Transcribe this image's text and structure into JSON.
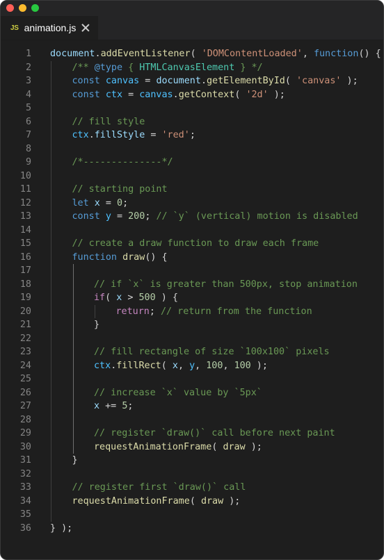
{
  "window": {
    "controls": [
      "close",
      "minimize",
      "maximize"
    ],
    "colors": {
      "close": "#ff5f57",
      "minimize": "#febc2e",
      "maximize": "#28c840"
    }
  },
  "tab": {
    "icon_text": "JS",
    "icon": "javascript-file-icon",
    "label": "animation.js",
    "close_icon": "close-icon"
  },
  "theme": {
    "background": "#1e1e1e",
    "keyword": "#569cd6",
    "string": "#ce9178",
    "number": "#b5cea8",
    "comment": "#6a9955",
    "function": "#dcdcaa",
    "variable": "#9cdcfe"
  },
  "lines": [
    {
      "n": "1",
      "indent": 0,
      "tokens": [
        {
          "t": "document",
          "c": "var"
        },
        {
          "t": ".",
          "c": "plain"
        },
        {
          "t": "addEventListener",
          "c": "func"
        },
        {
          "t": "( ",
          "c": "plain"
        },
        {
          "t": "'DOMContentLoaded'",
          "c": "string"
        },
        {
          "t": ", ",
          "c": "plain"
        },
        {
          "t": "function",
          "c": "keyword"
        },
        {
          "t": "() {",
          "c": "plain"
        }
      ]
    },
    {
      "n": "2",
      "indent": 1,
      "tokens": [
        {
          "t": "/** ",
          "c": "comment"
        },
        {
          "t": "@type",
          "c": "keyword"
        },
        {
          "t": " { ",
          "c": "comment"
        },
        {
          "t": "HTMLCanvasElement",
          "c": "type"
        },
        {
          "t": " } */",
          "c": "comment"
        }
      ]
    },
    {
      "n": "3",
      "indent": 1,
      "tokens": [
        {
          "t": "const",
          "c": "keyword"
        },
        {
          "t": " ",
          "c": "plain"
        },
        {
          "t": "canvas",
          "c": "const"
        },
        {
          "t": " = ",
          "c": "plain"
        },
        {
          "t": "document",
          "c": "var"
        },
        {
          "t": ".",
          "c": "plain"
        },
        {
          "t": "getElementById",
          "c": "func"
        },
        {
          "t": "( ",
          "c": "plain"
        },
        {
          "t": "'canvas'",
          "c": "string"
        },
        {
          "t": " );",
          "c": "plain"
        }
      ]
    },
    {
      "n": "4",
      "indent": 1,
      "tokens": [
        {
          "t": "const",
          "c": "keyword"
        },
        {
          "t": " ",
          "c": "plain"
        },
        {
          "t": "ctx",
          "c": "const"
        },
        {
          "t": " = ",
          "c": "plain"
        },
        {
          "t": "canvas",
          "c": "const"
        },
        {
          "t": ".",
          "c": "plain"
        },
        {
          "t": "getContext",
          "c": "func"
        },
        {
          "t": "( ",
          "c": "plain"
        },
        {
          "t": "'2d'",
          "c": "string"
        },
        {
          "t": " );",
          "c": "plain"
        }
      ]
    },
    {
      "n": "5",
      "indent": 0,
      "tokens": []
    },
    {
      "n": "6",
      "indent": 1,
      "tokens": [
        {
          "t": "// fill style",
          "c": "comment"
        }
      ]
    },
    {
      "n": "7",
      "indent": 1,
      "tokens": [
        {
          "t": "ctx",
          "c": "const"
        },
        {
          "t": ".",
          "c": "plain"
        },
        {
          "t": "fillStyle",
          "c": "var"
        },
        {
          "t": " = ",
          "c": "plain"
        },
        {
          "t": "'red'",
          "c": "string"
        },
        {
          "t": ";",
          "c": "plain"
        }
      ]
    },
    {
      "n": "8",
      "indent": 0,
      "tokens": []
    },
    {
      "n": "9",
      "indent": 1,
      "tokens": [
        {
          "t": "/*--------------*/",
          "c": "comment"
        }
      ]
    },
    {
      "n": "10",
      "indent": 0,
      "tokens": []
    },
    {
      "n": "11",
      "indent": 1,
      "tokens": [
        {
          "t": "// starting point",
          "c": "comment"
        }
      ]
    },
    {
      "n": "12",
      "indent": 1,
      "tokens": [
        {
          "t": "let",
          "c": "keyword"
        },
        {
          "t": " ",
          "c": "plain"
        },
        {
          "t": "x",
          "c": "var"
        },
        {
          "t": " = ",
          "c": "plain"
        },
        {
          "t": "0",
          "c": "number"
        },
        {
          "t": ";",
          "c": "plain"
        }
      ]
    },
    {
      "n": "13",
      "indent": 1,
      "tokens": [
        {
          "t": "const",
          "c": "keyword"
        },
        {
          "t": " ",
          "c": "plain"
        },
        {
          "t": "y",
          "c": "const"
        },
        {
          "t": " = ",
          "c": "plain"
        },
        {
          "t": "200",
          "c": "number"
        },
        {
          "t": "; ",
          "c": "plain"
        },
        {
          "t": "// `y` (vertical) motion is disabled",
          "c": "comment"
        }
      ]
    },
    {
      "n": "14",
      "indent": 0,
      "tokens": []
    },
    {
      "n": "15",
      "indent": 1,
      "tokens": [
        {
          "t": "// create a draw function to draw each frame",
          "c": "comment"
        }
      ]
    },
    {
      "n": "16",
      "indent": 1,
      "tokens": [
        {
          "t": "function",
          "c": "keyword"
        },
        {
          "t": " ",
          "c": "plain"
        },
        {
          "t": "draw",
          "c": "func"
        },
        {
          "t": "() {",
          "c": "plain"
        }
      ]
    },
    {
      "n": "17",
      "indent": 0,
      "tokens": []
    },
    {
      "n": "18",
      "indent": 2,
      "tokens": [
        {
          "t": "// if `x` is greater than 500px, stop animation",
          "c": "comment"
        }
      ]
    },
    {
      "n": "19",
      "indent": 2,
      "tokens": [
        {
          "t": "if",
          "c": "control"
        },
        {
          "t": "( ",
          "c": "plain"
        },
        {
          "t": "x",
          "c": "var"
        },
        {
          "t": " > ",
          "c": "plain"
        },
        {
          "t": "500",
          "c": "number"
        },
        {
          "t": " ) {",
          "c": "plain"
        }
      ]
    },
    {
      "n": "20",
      "indent": 3,
      "tokens": [
        {
          "t": "return",
          "c": "control"
        },
        {
          "t": "; ",
          "c": "plain"
        },
        {
          "t": "// return from the function",
          "c": "comment"
        }
      ]
    },
    {
      "n": "21",
      "indent": 2,
      "tokens": [
        {
          "t": "}",
          "c": "plain"
        }
      ]
    },
    {
      "n": "22",
      "indent": 0,
      "tokens": []
    },
    {
      "n": "23",
      "indent": 2,
      "tokens": [
        {
          "t": "// fill rectangle of size `100x100` pixels",
          "c": "comment"
        }
      ]
    },
    {
      "n": "24",
      "indent": 2,
      "tokens": [
        {
          "t": "ctx",
          "c": "const"
        },
        {
          "t": ".",
          "c": "plain"
        },
        {
          "t": "fillRect",
          "c": "func"
        },
        {
          "t": "( ",
          "c": "plain"
        },
        {
          "t": "x",
          "c": "var"
        },
        {
          "t": ", ",
          "c": "plain"
        },
        {
          "t": "y",
          "c": "const"
        },
        {
          "t": ", ",
          "c": "plain"
        },
        {
          "t": "100",
          "c": "number"
        },
        {
          "t": ", ",
          "c": "plain"
        },
        {
          "t": "100",
          "c": "number"
        },
        {
          "t": " );",
          "c": "plain"
        }
      ]
    },
    {
      "n": "25",
      "indent": 0,
      "tokens": []
    },
    {
      "n": "26",
      "indent": 2,
      "tokens": [
        {
          "t": "// increase `x` value by `5px`",
          "c": "comment"
        }
      ]
    },
    {
      "n": "27",
      "indent": 2,
      "tokens": [
        {
          "t": "x",
          "c": "var"
        },
        {
          "t": " += ",
          "c": "plain"
        },
        {
          "t": "5",
          "c": "number"
        },
        {
          "t": ";",
          "c": "plain"
        }
      ]
    },
    {
      "n": "28",
      "indent": 0,
      "tokens": []
    },
    {
      "n": "29",
      "indent": 2,
      "tokens": [
        {
          "t": "// register `draw()` call before next paint",
          "c": "comment"
        }
      ]
    },
    {
      "n": "30",
      "indent": 2,
      "tokens": [
        {
          "t": "requestAnimationFrame",
          "c": "func"
        },
        {
          "t": "( ",
          "c": "plain"
        },
        {
          "t": "draw",
          "c": "func"
        },
        {
          "t": " );",
          "c": "plain"
        }
      ]
    },
    {
      "n": "31",
      "indent": 1,
      "tokens": [
        {
          "t": "}",
          "c": "plain"
        }
      ]
    },
    {
      "n": "32",
      "indent": 0,
      "tokens": []
    },
    {
      "n": "33",
      "indent": 1,
      "tokens": [
        {
          "t": "// register first `draw()` call",
          "c": "comment"
        }
      ]
    },
    {
      "n": "34",
      "indent": 1,
      "tokens": [
        {
          "t": "requestAnimationFrame",
          "c": "func"
        },
        {
          "t": "( ",
          "c": "plain"
        },
        {
          "t": "draw",
          "c": "func"
        },
        {
          "t": " );",
          "c": "plain"
        }
      ]
    },
    {
      "n": "35",
      "indent": 0,
      "tokens": []
    },
    {
      "n": "36",
      "indent": 0,
      "tokens": [
        {
          "t": "} );",
          "c": "plain"
        }
      ]
    }
  ]
}
